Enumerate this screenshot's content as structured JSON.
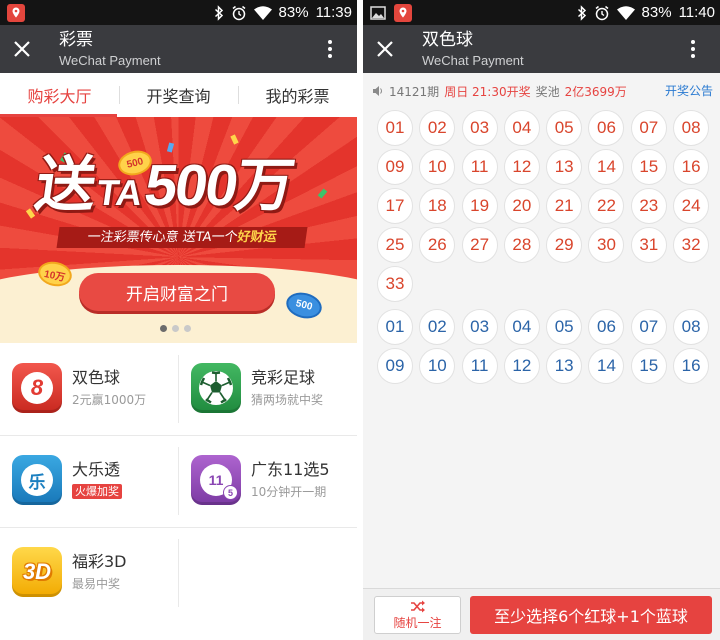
{
  "colors": {
    "accent_red": "#e64340",
    "ball_red": "#d9452c",
    "ball_blue": "#2b64a8",
    "link_blue": "#2a7ad1",
    "titlebar": "#3a3b3f",
    "statusbar": "#141414"
  },
  "left": {
    "status_bar": {
      "battery": "83%",
      "time": "11:39",
      "icons": [
        "location-app-icon",
        "bluetooth-icon",
        "alarm-icon",
        "wifi-icon"
      ]
    },
    "title_bar": {
      "title": "彩票",
      "subtitle": "WeChat Payment"
    },
    "tabs": [
      {
        "label": "购彩大厅",
        "active": true
      },
      {
        "label": "开奖查询",
        "active": false
      },
      {
        "label": "我的彩票",
        "active": false
      }
    ],
    "banner": {
      "headline": {
        "part1": "送",
        "part2": "TA",
        "part3": "500万"
      },
      "tagline": {
        "part1": "一注彩票传心意 送TA一个",
        "part2": "好财运"
      },
      "coins": [
        "500",
        "10万",
        "500"
      ],
      "button_label": "开启财富之门",
      "carousel": {
        "pages": 3,
        "active": 1
      }
    },
    "lotteries": [
      {
        "name": "双色球",
        "desc": "2元赢1000万",
        "icon": "red-ball-icon",
        "icon_text": "8"
      },
      {
        "name": "竞彩足球",
        "desc": "猜两场就中奖",
        "icon": "soccer-ball-icon"
      },
      {
        "name": "大乐透",
        "badge": "火爆加奖",
        "icon": "blue-ball-icon",
        "icon_text": "乐"
      },
      {
        "name": "广东11选5",
        "desc": "10分钟开一期",
        "icon": "purple-ball-icon",
        "icon_text": "11",
        "icon_text2": "5"
      },
      {
        "name": "福彩3D",
        "desc": "最易中奖",
        "icon": "3d-icon",
        "icon_text": "3D"
      }
    ]
  },
  "right": {
    "status_bar": {
      "battery": "83%",
      "time": "11:40",
      "icons": [
        "gallery-icon",
        "location-app-icon",
        "bluetooth-icon",
        "alarm-icon",
        "wifi-icon"
      ]
    },
    "title_bar": {
      "title": "双色球",
      "subtitle": "WeChat Payment"
    },
    "draw_info": {
      "issue": "14121期",
      "draw_time": "周日 21:30开奖",
      "pool_label": "奖池",
      "pool_amount": "2亿3699万",
      "notice_link": "开奖公告"
    },
    "red_balls": [
      "01",
      "02",
      "03",
      "04",
      "05",
      "06",
      "07",
      "08",
      "09",
      "10",
      "11",
      "12",
      "13",
      "14",
      "15",
      "16",
      "17",
      "18",
      "19",
      "20",
      "21",
      "22",
      "23",
      "24",
      "25",
      "26",
      "27",
      "28",
      "29",
      "30",
      "31",
      "32",
      "33"
    ],
    "blue_balls": [
      "01",
      "02",
      "03",
      "04",
      "05",
      "06",
      "07",
      "08",
      "09",
      "10",
      "11",
      "12",
      "13",
      "14",
      "15",
      "16"
    ],
    "actions": {
      "random_label": "随机一注",
      "submit_label": "至少选择6个红球+1个蓝球"
    }
  }
}
